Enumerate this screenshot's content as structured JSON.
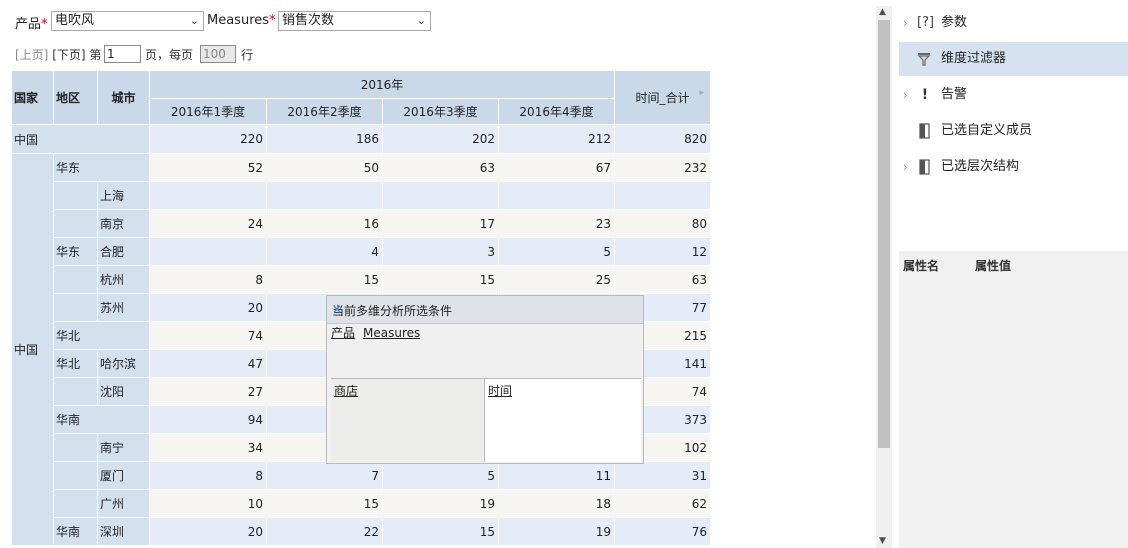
{
  "filters": {
    "product_label": "产品",
    "product_required": "*",
    "product_value": "电吹风",
    "measures_label": "Measures",
    "measures_required": "*",
    "measures_value": "销售次数"
  },
  "pager": {
    "prev": "[上页]",
    "next": "[下页]",
    "page_prefix": "第",
    "page_value": "1",
    "page_suffix": "页，每页",
    "per_page_value": "100",
    "rows_suffix": "行"
  },
  "table": {
    "headers": {
      "country": "国家",
      "region": "地区",
      "city": "城市",
      "year": "2016年",
      "quarters": [
        "2016年1季度",
        "2016年2季度",
        "2016年3季度",
        "2016年4季度"
      ],
      "total": "时间_合计"
    },
    "china_total": {
      "label": "中国",
      "values": [
        "220",
        "186",
        "202",
        "212",
        "820"
      ]
    },
    "country_label": "中国",
    "rows": [
      {
        "region": "华东",
        "city": "",
        "values": [
          "52",
          "50",
          "63",
          "67",
          "232"
        ]
      },
      {
        "region": "",
        "city": "上海",
        "values": [
          "",
          "",
          "",
          "",
          ""
        ]
      },
      {
        "region": "",
        "city": "南京",
        "values": [
          "24",
          "16",
          "17",
          "23",
          "80"
        ]
      },
      {
        "region": "华东",
        "city": "合肥",
        "values": [
          "",
          "4",
          "3",
          "5",
          "12"
        ]
      },
      {
        "region": "",
        "city": "杭州",
        "values": [
          "8",
          "15",
          "15",
          "25",
          "63"
        ]
      },
      {
        "region": "",
        "city": "苏州",
        "values": [
          "20",
          "",
          "",
          "",
          "77"
        ]
      },
      {
        "region": "华北",
        "city": "",
        "values": [
          "74",
          "",
          "",
          "",
          "215"
        ]
      },
      {
        "region": "华北",
        "city": "哈尔滨",
        "values": [
          "47",
          "",
          "",
          "",
          "141"
        ]
      },
      {
        "region": "",
        "city": "沈阳",
        "values": [
          "27",
          "",
          "",
          "",
          "74"
        ]
      },
      {
        "region": "华南",
        "city": "",
        "values": [
          "94",
          "",
          "",
          "",
          "373"
        ]
      },
      {
        "region": "",
        "city": "南宁",
        "values": [
          "34",
          "",
          "",
          "",
          "102"
        ]
      },
      {
        "region": "",
        "city": "厦门",
        "values": [
          "8",
          "7",
          "5",
          "11",
          "31"
        ]
      },
      {
        "region": "",
        "city": "广州",
        "values": [
          "10",
          "15",
          "19",
          "18",
          "62"
        ]
      },
      {
        "region": "华南",
        "city": "深圳",
        "values": [
          "20",
          "22",
          "15",
          "19",
          "76"
        ]
      }
    ]
  },
  "dialog": {
    "title": "当前多维分析所选条件",
    "close_glyph": "×",
    "top_items": [
      "产品",
      "Measures"
    ],
    "left_item": "商店",
    "right_item": "时间"
  },
  "right_panel": {
    "items": [
      {
        "label": "参数",
        "icon": "parameter-icon",
        "glyph": "[?]",
        "chevron": true
      },
      {
        "label": "维度过滤器",
        "icon": "filter-icon",
        "glyph": "",
        "chevron": false
      },
      {
        "label": "告警",
        "icon": "alert-icon",
        "glyph": "!",
        "chevron": true
      },
      {
        "label": "已选自定义成员",
        "icon": "member-icon",
        "glyph": "",
        "chevron": false
      },
      {
        "label": "已选层次结构",
        "icon": "hierarchy-icon",
        "glyph": "",
        "chevron": true
      }
    ],
    "properties": {
      "name_header": "属性名",
      "value_header": "属性值"
    }
  }
}
